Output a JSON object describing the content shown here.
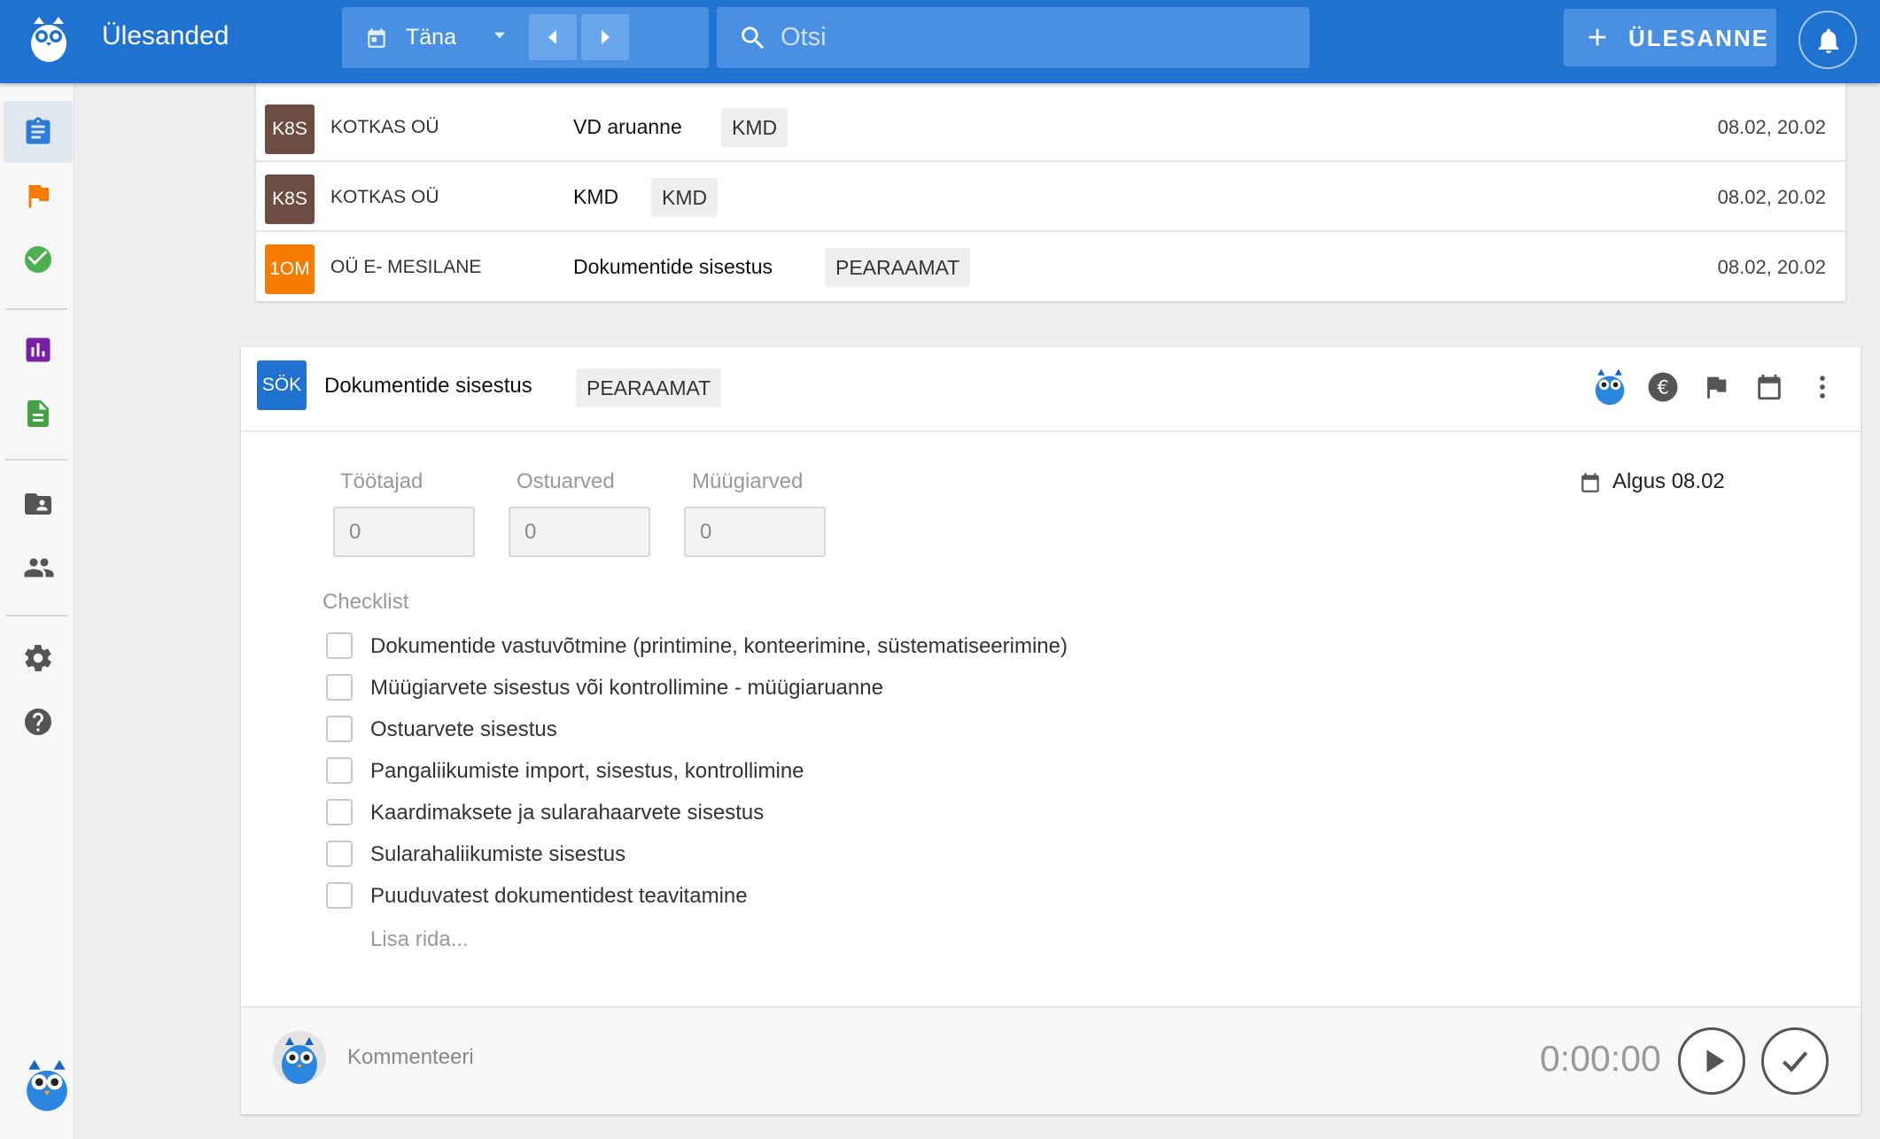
{
  "header": {
    "title": "Ülesanded",
    "date_label": "Täna",
    "search_placeholder": "Otsi",
    "add_task_label": "ÜLESANNE"
  },
  "sidebar": {
    "items": [
      {
        "name": "tasks",
        "icon": "clipboard-icon",
        "color": "#2d7bd8",
        "active": true
      },
      {
        "name": "flagged",
        "icon": "flag-icon",
        "color": "#f57c00"
      },
      {
        "name": "done",
        "icon": "check-circle-icon",
        "color": "#4caf50"
      },
      {
        "name": "reports",
        "icon": "bar-chart-icon",
        "color": "#7b1fa2"
      },
      {
        "name": "documents",
        "icon": "document-icon",
        "color": "#43a047"
      },
      {
        "name": "clients",
        "icon": "contact-folder-icon",
        "color": "#555555"
      },
      {
        "name": "people",
        "icon": "people-icon",
        "color": "#555555"
      },
      {
        "name": "settings",
        "icon": "gear-icon",
        "color": "#555555"
      },
      {
        "name": "help",
        "icon": "help-icon",
        "color": "#555555"
      }
    ]
  },
  "task_list": [
    {
      "badge": "K8S",
      "badge_color": "#6d4c41",
      "company": "KOTKAS OÜ",
      "name": "VD aruanne",
      "tag": "KMD",
      "date": "08.02, 20.02"
    },
    {
      "badge": "K8S",
      "badge_color": "#6d4c41",
      "company": "KOTKAS OÜ",
      "name": "KMD",
      "tag": "KMD",
      "date": "08.02, 20.02"
    },
    {
      "badge": "1OM",
      "badge_color": "#f57c00",
      "company": "OÜ E- MESILANE",
      "name": "Dokumentide sisestus",
      "tag": "PEARAAMAT",
      "date": "08.02, 20.02"
    }
  ],
  "detail": {
    "badge": "SÖK",
    "badge_color": "#1f72cf",
    "title": "Dokumentide sisestus",
    "tag": "PEARAAMAT",
    "fields": [
      {
        "label": "Töötajad",
        "value": "0"
      },
      {
        "label": "Ostuarved",
        "value": "0"
      },
      {
        "label": "Müügiarved",
        "value": "0"
      }
    ],
    "start_date": "Algus 08.02",
    "checklist_title": "Checklist",
    "checklist": [
      "Dokumentide vastuvõtmine (printimine, konteerimine, süstematiseerimine)",
      "Müügiarvete sisestus või kontrollimine - müügiaruanne",
      "Ostuarvete sisestus",
      "Pangaliikumiste import, sisestus, kontrollimine",
      "Kaardimaksete ja sularahaarvete sisestus",
      "Sularahaliikumiste sisestus",
      "Puuduvatest dokumentidest teavitamine"
    ],
    "add_row": "Lisa rida...",
    "comment_placeholder": "Kommenteeri",
    "timer": "0:00:00"
  }
}
